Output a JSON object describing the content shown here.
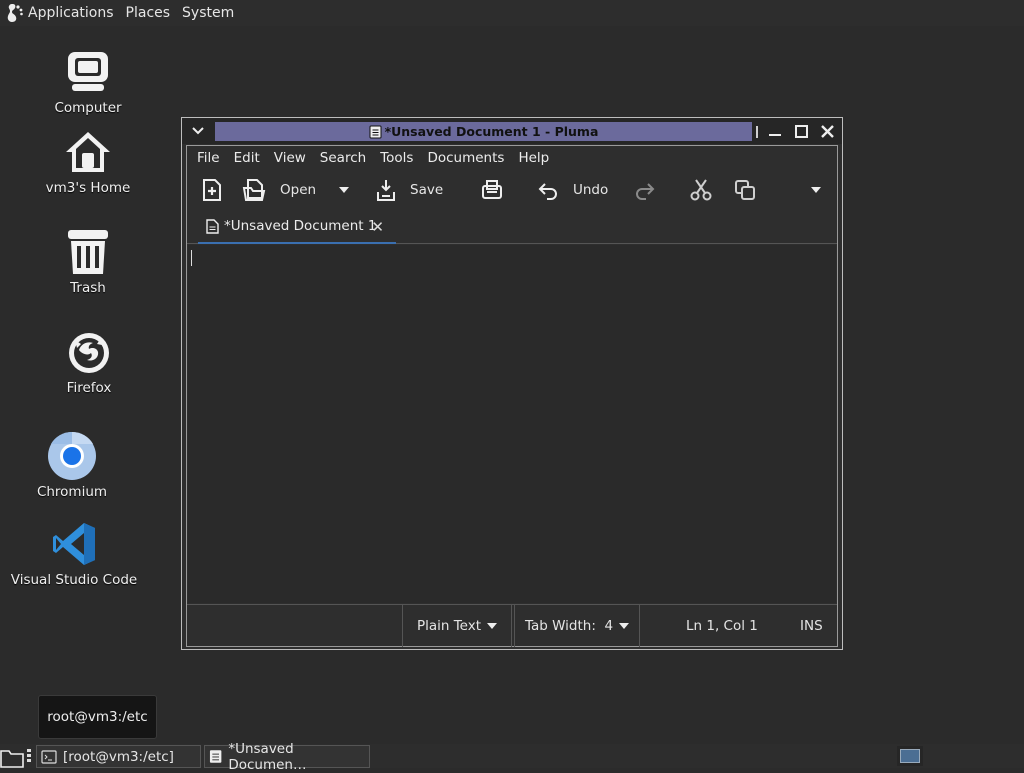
{
  "top_panel": {
    "menus": [
      "Applications",
      "Places",
      "System"
    ],
    "icons": {
      "applications": "gnome-foot-icon"
    }
  },
  "desktop": {
    "icons": [
      {
        "label": "Computer",
        "icon": "computer-icon"
      },
      {
        "label": "vm3's Home",
        "icon": "home-icon"
      },
      {
        "label": "Trash",
        "icon": "trash-icon"
      },
      {
        "label": "Firefox",
        "icon": "firefox-icon"
      },
      {
        "label": "Chromium",
        "icon": "chromium-icon"
      },
      {
        "label": "Visual Studio Code",
        "icon": "vscode-icon"
      }
    ]
  },
  "window": {
    "title": "*Unsaved Document 1 - Pluma",
    "menubar": [
      "File",
      "Edit",
      "View",
      "Search",
      "Tools",
      "Documents",
      "Help"
    ],
    "toolbar": {
      "open_label": "Open",
      "save_label": "Save",
      "undo_label": "Undo"
    },
    "tab": {
      "label": "*Unsaved Document 1",
      "close": "✕"
    },
    "editor": {
      "text": ""
    },
    "statusbar": {
      "language": "Plain Text",
      "tab_width": "Tab Width:  4",
      "position": "Ln 1, Col 1",
      "mode": "INS"
    }
  },
  "tooltip": {
    "text": "root@vm3:/etc"
  },
  "taskbar": {
    "tasks": [
      {
        "label": "[root@vm3:/etc]",
        "icon": "terminal-icon"
      },
      {
        "label": "*Unsaved Documen…",
        "icon": "document-icon"
      }
    ]
  },
  "colors": {
    "title_highlight": "#6b6a9c",
    "tab_underline": "#3a6fb0",
    "workspace_active": "#4b6e93"
  }
}
